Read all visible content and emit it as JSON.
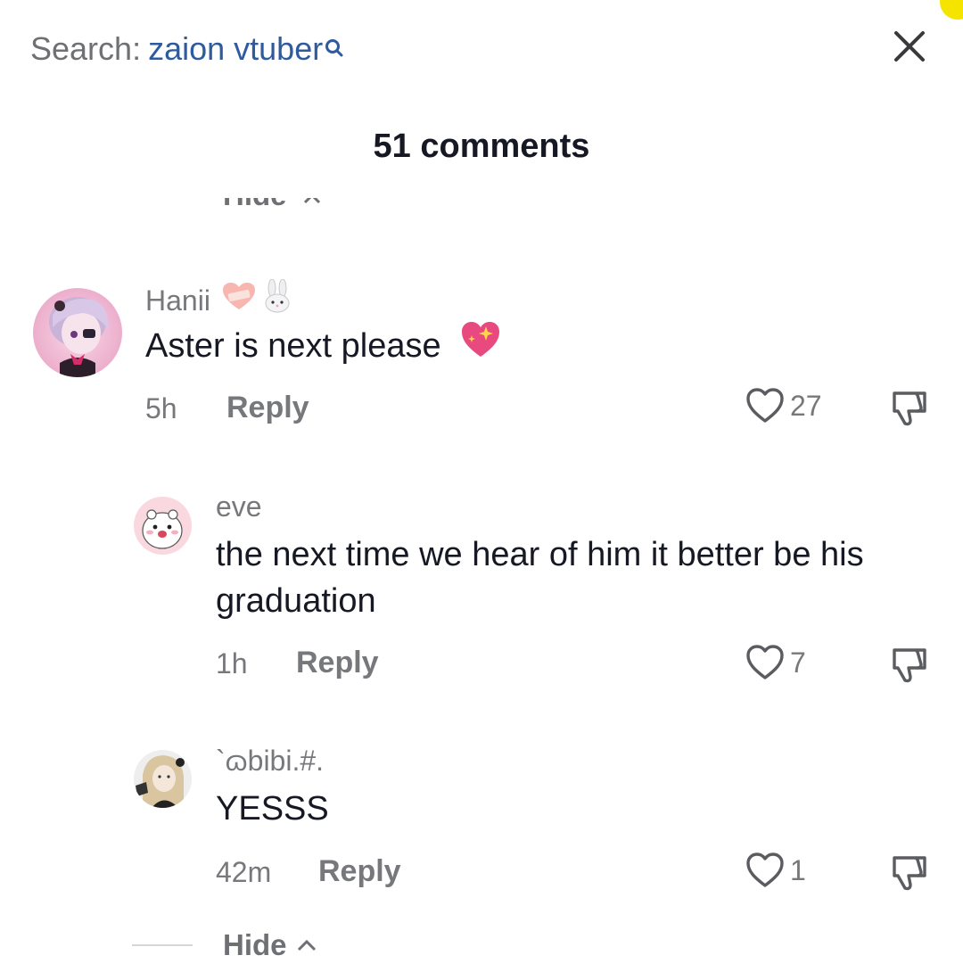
{
  "header": {
    "search_prefix": "Search:",
    "search_query": "zaion vtuber",
    "title": "51 comments"
  },
  "clipped_hide_label": "Hide",
  "comments": [
    {
      "username": "Hanii",
      "username_emojis": [
        "bandaged-heart-emoji",
        "rabbit-emoji"
      ],
      "text": "Aster is next please",
      "text_emoji": "sparkling-heart-emoji",
      "time": "5h",
      "reply_label": "Reply",
      "likes": "27"
    },
    {
      "username": "eve",
      "text": "the next time we hear of him it better be his graduation",
      "time": "1h",
      "reply_label": "Reply",
      "likes": "7"
    },
    {
      "username": "`ɷbibi.#.",
      "text": "YESSS",
      "time": "42m",
      "reply_label": "Reply",
      "likes": "1"
    }
  ],
  "footer": {
    "hide_label": "Hide"
  },
  "colors": {
    "query_blue": "#2e5a9e",
    "muted_gray": "#77787c",
    "text_dark": "#161823",
    "accent_yellow": "#f5e400"
  }
}
